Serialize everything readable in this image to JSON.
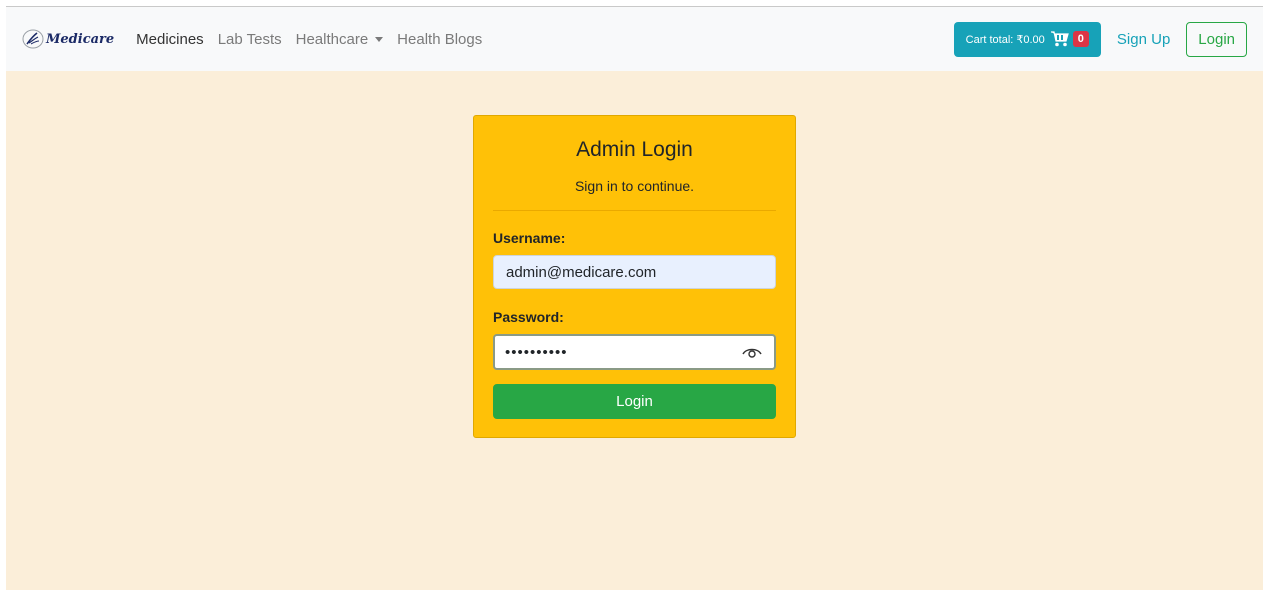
{
  "navbar": {
    "brand": {
      "text": "Medicare",
      "icon": "medicare-logo-icon"
    },
    "links": [
      {
        "label": "Medicines",
        "active": true
      },
      {
        "label": "Lab Tests",
        "active": false
      },
      {
        "label": "Healthcare",
        "active": false,
        "dropdown": true
      },
      {
        "label": "Health Blogs",
        "active": false
      }
    ],
    "cart": {
      "label": "Cart total: ₹0.00",
      "icon": "cart-icon",
      "count": "0"
    },
    "signup_label": "Sign Up",
    "login_label": "Login"
  },
  "login_card": {
    "title": "Admin Login",
    "subtitle": "Sign in to continue.",
    "username_label": "Username:",
    "username_value": "admin@medicare.com",
    "password_label": "Password:",
    "password_value": "••••••••••",
    "password_toggle_icon": "eye-icon",
    "submit_label": "Login"
  },
  "colors": {
    "page_background": "#fbeed9",
    "navbar_background": "#f8f9fa",
    "card_background": "#ffc107",
    "cart_button": "#17a2b8",
    "cart_badge": "#dc3545",
    "primary_green": "#28a745"
  }
}
